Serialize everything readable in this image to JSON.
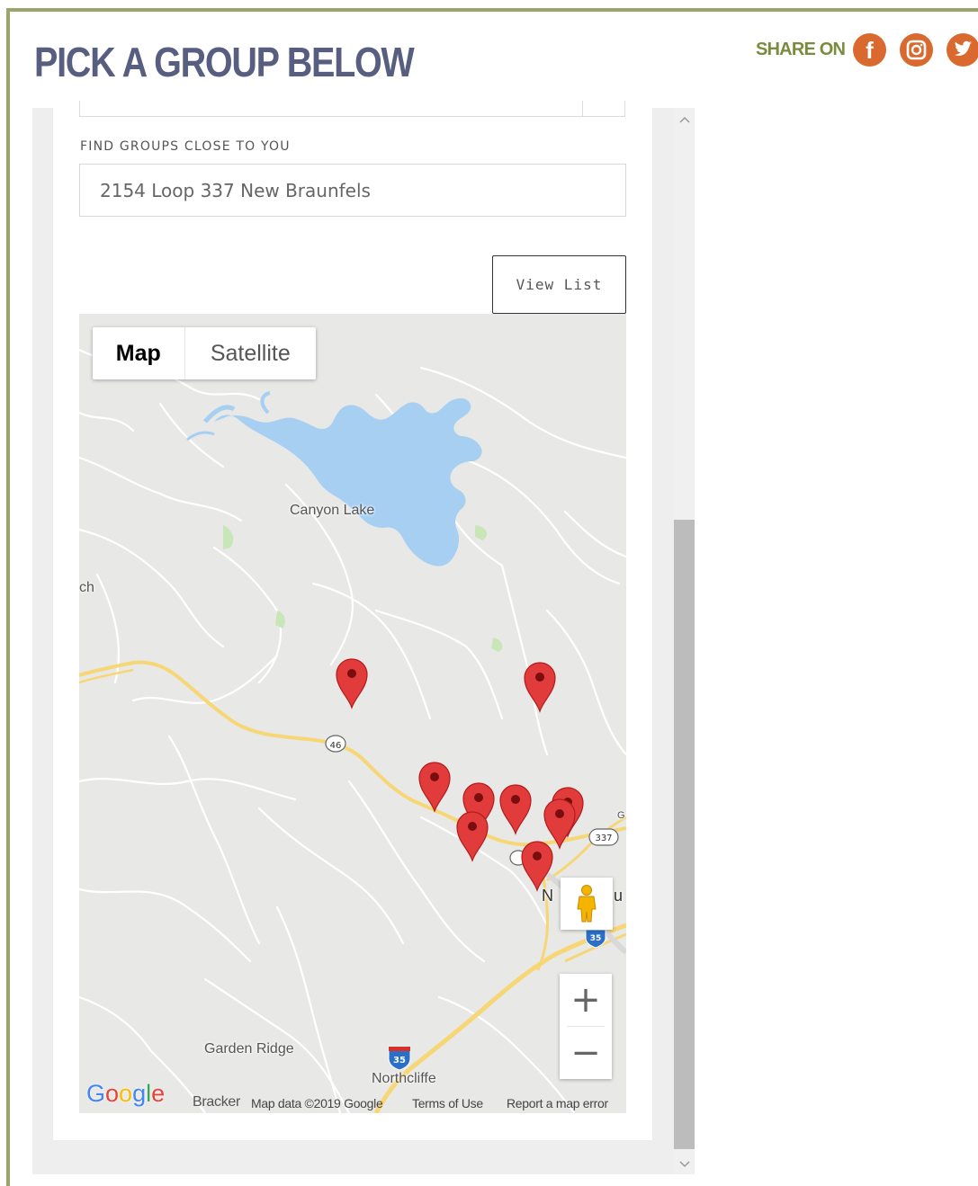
{
  "page": {
    "title": "PICK A GROUP BELOW",
    "share_label": "SHARE ON",
    "social_icons": [
      "facebook-icon",
      "instagram-icon",
      "twitter-icon"
    ],
    "accent_color": "#d9692e",
    "title_color": "#575e80",
    "share_color": "#7a8b3e",
    "frame_color": "#9aa56a"
  },
  "search": {
    "label": "FIND GROUPS CLOSE TO YOU",
    "value": "2154 Loop 337 New Braunfels"
  },
  "view_list_label": "View List",
  "map": {
    "type_buttons": {
      "map": "Map",
      "satellite": "Satellite"
    },
    "selected_type": "Map",
    "labels": {
      "canyon_lake": "Canyon Lake",
      "edge_ch": "ch",
      "garden_ridge": "Garden Ridge",
      "northcliffe": "Northcliffe",
      "new_braunfels_partial_left": "N",
      "new_braunfels_partial_right": "u",
      "edge_g": "G",
      "route_46": "46",
      "route_337": "337",
      "route_35": "35",
      "route_i35": "35"
    },
    "zoom_in": "+",
    "zoom_out": "−",
    "attribution": {
      "google": "Google",
      "bracker": "Bracker",
      "map_data": "Map data ©2019 Google",
      "terms": "Terms of Use",
      "report": "Report a map error"
    },
    "pin_color": "#e23b3b",
    "water_color": "#a6cff2",
    "road_color": "#f7d675"
  }
}
